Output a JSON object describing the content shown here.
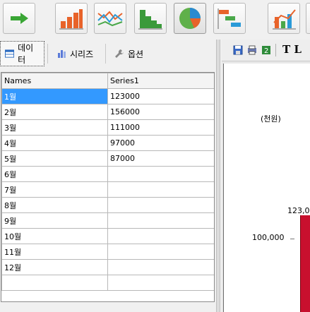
{
  "toolbar": {
    "buttons": [
      {
        "name": "arrow",
        "icon": "right-arrow-icon"
      },
      {
        "name": "bar-chart",
        "icon": "bar-chart-icon"
      },
      {
        "name": "line-chart",
        "icon": "line-chart-icon"
      },
      {
        "name": "step-chart",
        "icon": "step-chart-icon"
      },
      {
        "name": "pie-chart",
        "icon": "pie-chart-icon"
      },
      {
        "name": "gantt-chart",
        "icon": "gantt-chart-icon"
      },
      {
        "name": "combo-chart",
        "icon": "combo-chart-icon"
      }
    ]
  },
  "tabs": [
    {
      "label": "데이터",
      "icon": "table-icon"
    },
    {
      "label": "시리즈",
      "icon": "series-icon"
    },
    {
      "label": "옵션",
      "icon": "wrench-icon"
    }
  ],
  "grid": {
    "headers": [
      "Names",
      "Series1"
    ],
    "rows": [
      [
        "1월",
        "123000"
      ],
      [
        "2월",
        "156000"
      ],
      [
        "3월",
        "111000"
      ],
      [
        "4월",
        "97000"
      ],
      [
        "5월",
        "87000"
      ],
      [
        "6월",
        ""
      ],
      [
        "7월",
        ""
      ],
      [
        "8월",
        ""
      ],
      [
        "9월",
        ""
      ],
      [
        "10월",
        ""
      ],
      [
        "11월",
        ""
      ],
      [
        "12월",
        ""
      ],
      [
        "",
        ""
      ]
    ]
  },
  "preview": {
    "toolbar_text": "T L",
    "unit_label": "(천원)",
    "axis_value": "100,000",
    "bar_label": "123,0",
    "bar_color": "#c8102e"
  }
}
